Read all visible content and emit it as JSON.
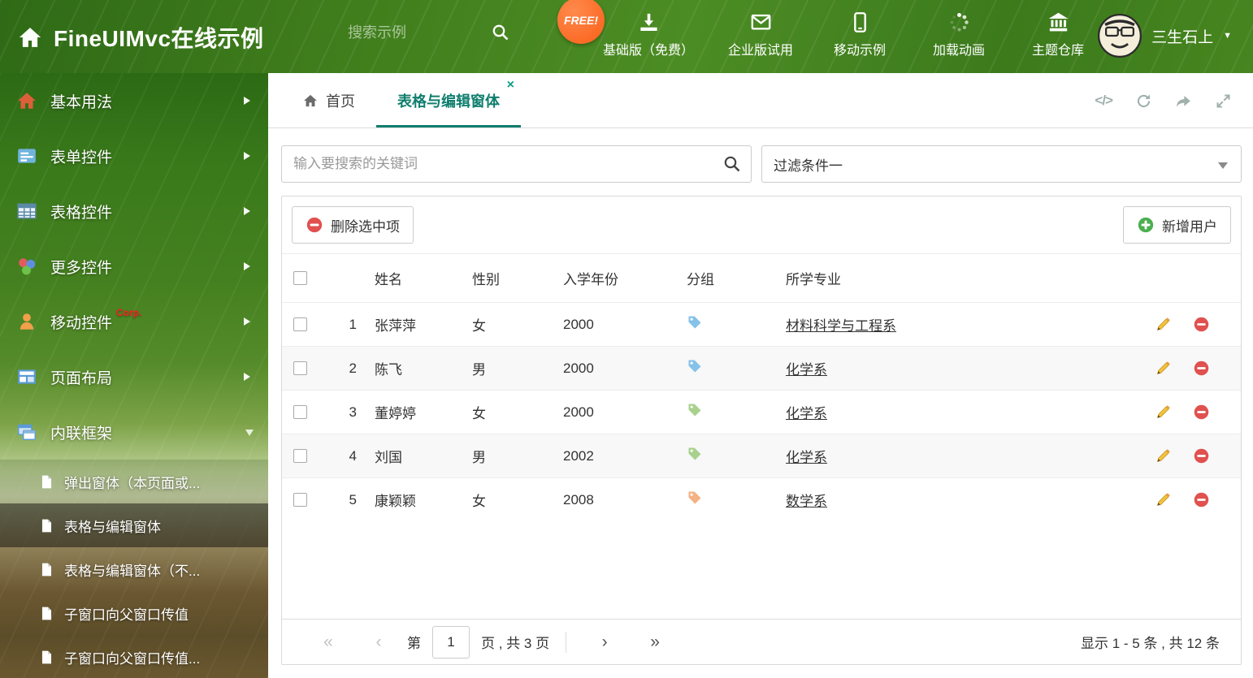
{
  "colors": {
    "header_green": "#41801e",
    "accent_teal": "#0f7e6e",
    "danger_red": "#e0514f",
    "success_green": "#4caf50",
    "pencil_yellow": "#f3c13a"
  },
  "icons": {
    "code": "</>",
    "close_tab": "×",
    "caret_down": "▼",
    "first_page": "«",
    "prev_page": "‹",
    "next_page": "›",
    "last_page": "»"
  },
  "header": {
    "title": "FineUIMvc在线示例",
    "search_placeholder": "搜索示例",
    "free_badge": "FREE!",
    "nav": [
      {
        "label": "基础版（免费）",
        "icon": "download-icon"
      },
      {
        "label": "企业版试用",
        "icon": "mail-icon"
      },
      {
        "label": "移动示例",
        "icon": "mobile-icon"
      },
      {
        "label": "加载动画",
        "icon": "spinner-icon"
      },
      {
        "label": "主题仓库",
        "icon": "bank-icon"
      }
    ],
    "user": {
      "name": "三生石上"
    }
  },
  "sidebar": {
    "items": [
      {
        "label": "基本用法"
      },
      {
        "label": "表单控件"
      },
      {
        "label": "表格控件"
      },
      {
        "label": "更多控件"
      },
      {
        "label": "移动控件",
        "badge": "Corp."
      },
      {
        "label": "页面布局"
      },
      {
        "label": "内联框架"
      }
    ],
    "subitems": [
      {
        "label": "弹出窗体（本页面或..."
      },
      {
        "label": "表格与编辑窗体"
      },
      {
        "label": "表格与编辑窗体（不..."
      },
      {
        "label": "子窗口向父窗口传值"
      },
      {
        "label": "子窗口向父窗口传值..."
      }
    ]
  },
  "tabs": [
    {
      "label": "首页"
    },
    {
      "label": "表格与编辑窗体"
    }
  ],
  "main": {
    "search_placeholder": "输入要搜索的关键词",
    "filter_value": "过滤条件一",
    "delete_button": "删除选中项",
    "add_button": "新增用户",
    "table": {
      "headers": [
        "姓名",
        "性别",
        "入学年份",
        "分组",
        "所学专业"
      ],
      "rows": [
        {
          "num": "1",
          "name": "张萍萍",
          "gender": "女",
          "year": "2000",
          "tag_color": "#85c1e9",
          "major": "材料科学与工程系"
        },
        {
          "num": "2",
          "name": "陈飞",
          "gender": "男",
          "year": "2000",
          "tag_color": "#85c1e9",
          "major": "化学系"
        },
        {
          "num": "3",
          "name": "董婷婷",
          "gender": "女",
          "year": "2000",
          "tag_color": "#a9d18e",
          "major": "化学系"
        },
        {
          "num": "4",
          "name": "刘国",
          "gender": "男",
          "year": "2002",
          "tag_color": "#a9d18e",
          "major": "化学系"
        },
        {
          "num": "5",
          "name": "康颖颖",
          "gender": "女",
          "year": "2008",
          "tag_color": "#f4b183",
          "major": "数学系"
        }
      ]
    },
    "pagination": {
      "prefix": "第",
      "page": "1",
      "suffix": "页 , 共 3 页",
      "summary": "显示 1 - 5 条 , 共 12 条"
    }
  }
}
